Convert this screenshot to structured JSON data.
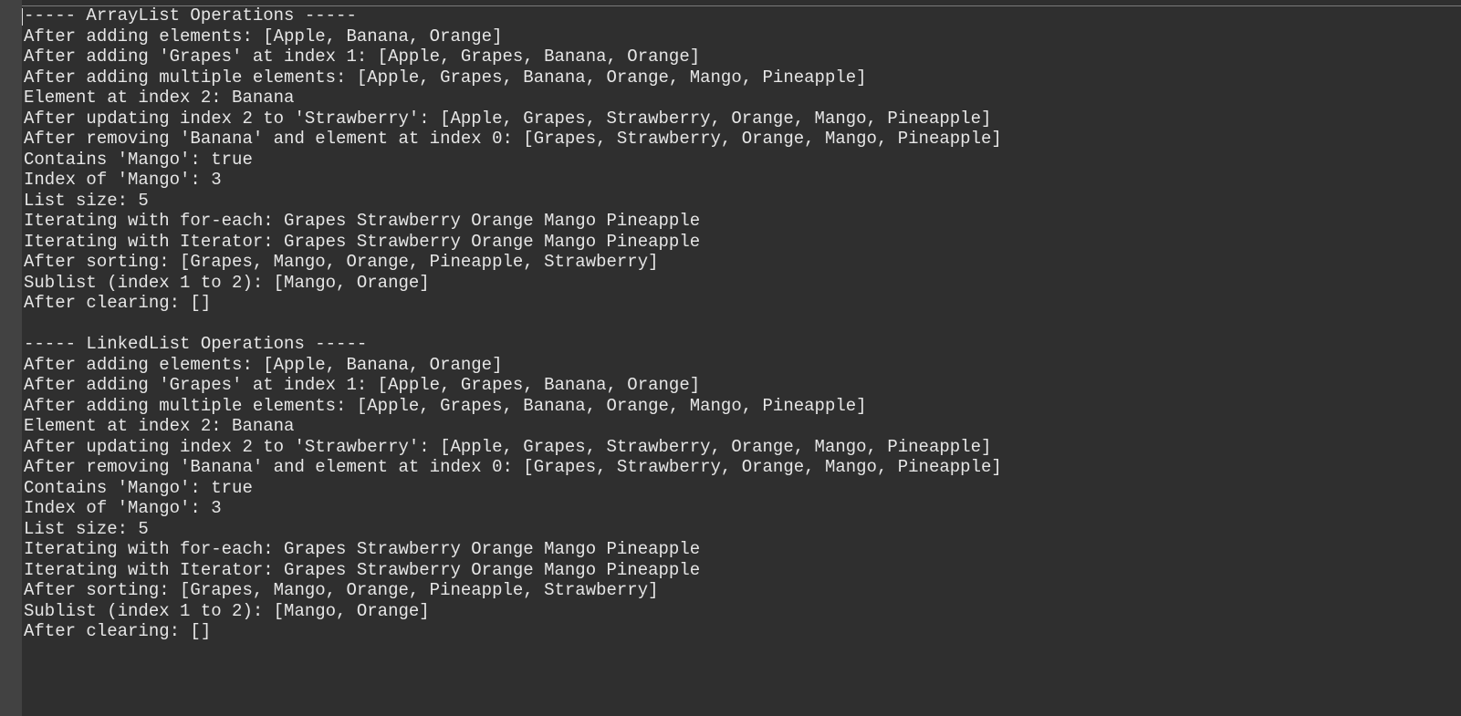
{
  "console": {
    "lines": [
      "----- ArrayList Operations -----",
      "After adding elements: [Apple, Banana, Orange]",
      "After adding 'Grapes' at index 1: [Apple, Grapes, Banana, Orange]",
      "After adding multiple elements: [Apple, Grapes, Banana, Orange, Mango, Pineapple]",
      "Element at index 2: Banana",
      "After updating index 2 to 'Strawberry': [Apple, Grapes, Strawberry, Orange, Mango, Pineapple]",
      "After removing 'Banana' and element at index 0: [Grapes, Strawberry, Orange, Mango, Pineapple]",
      "Contains 'Mango': true",
      "Index of 'Mango': 3",
      "List size: 5",
      "Iterating with for-each: Grapes Strawberry Orange Mango Pineapple",
      "Iterating with Iterator: Grapes Strawberry Orange Mango Pineapple",
      "After sorting: [Grapes, Mango, Orange, Pineapple, Strawberry]",
      "Sublist (index 1 to 2): [Mango, Orange]",
      "After clearing: []",
      "",
      "----- LinkedList Operations -----",
      "After adding elements: [Apple, Banana, Orange]",
      "After adding 'Grapes' at index 1: [Apple, Grapes, Banana, Orange]",
      "After adding multiple elements: [Apple, Grapes, Banana, Orange, Mango, Pineapple]",
      "Element at index 2: Banana",
      "After updating index 2 to 'Strawberry': [Apple, Grapes, Strawberry, Orange, Mango, Pineapple]",
      "After removing 'Banana' and element at index 0: [Grapes, Strawberry, Orange, Mango, Pineapple]",
      "Contains 'Mango': true",
      "Index of 'Mango': 3",
      "List size: 5",
      "Iterating with for-each: Grapes Strawberry Orange Mango Pineapple",
      "Iterating with Iterator: Grapes Strawberry Orange Mango Pineapple",
      "After sorting: [Grapes, Mango, Orange, Pineapple, Strawberry]",
      "Sublist (index 1 to 2): [Mango, Orange]",
      "After clearing: []"
    ]
  },
  "colors": {
    "background": "#2f2f2f",
    "gutter": "#424242",
    "text": "#e6e6e6"
  }
}
